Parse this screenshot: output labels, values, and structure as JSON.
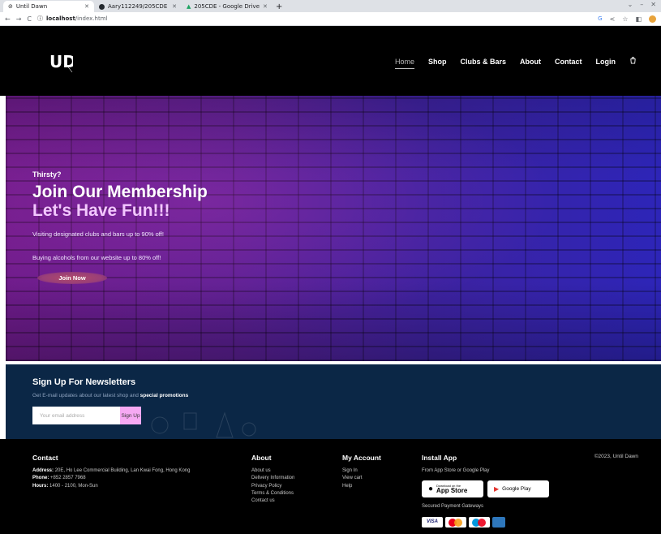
{
  "browser": {
    "tabs": [
      {
        "title": "Until Dawn",
        "active": true
      },
      {
        "title": "Aary112249/205CDE",
        "active": false
      },
      {
        "title": "205CDE - Google Drive",
        "active": false
      }
    ],
    "new_tab_symbol": "+",
    "url_host": "localhost",
    "url_path": "/index.html",
    "icons": [
      "back-icon",
      "forward-icon",
      "reload-icon",
      "info-icon",
      "google-icon",
      "share-icon",
      "star-icon",
      "sidebar-icon",
      "profile-icon"
    ]
  },
  "header": {
    "logo_text": "UD",
    "nav": [
      {
        "label": "Home",
        "active": true
      },
      {
        "label": "Shop"
      },
      {
        "label": "Clubs & Bars"
      },
      {
        "label": "About"
      },
      {
        "label": "Contact"
      },
      {
        "label": "Login"
      }
    ],
    "bag_icon": "shopping-bag-icon"
  },
  "hero": {
    "kicker": "Thirsty?",
    "title": "Join Our Membership",
    "title2": "Let's Have Fun!!!",
    "line1": "Visiting designated clubs and bars up to 90% off!",
    "line2": "Buying alcohols from our website up to 80% off!",
    "button": "Join Now",
    "colors": {
      "left": "#6d1b8a",
      "right": "#2d25b8"
    }
  },
  "newsletter": {
    "heading": "Sign Up For Newsletters",
    "sub_prefix": "Get E-mail updates about our latest shop and ",
    "sub_highlight": "special promotions",
    "placeholder": "Your email address",
    "button": "Sign Up",
    "bg": "#0b2746",
    "button_color": "#f6a9f3"
  },
  "footer": {
    "contact": {
      "heading": "Contact",
      "address_label": "Address:",
      "address": "20E, Ho Lee Commercial Building, Lan Kwai Fong, Hong Kong",
      "phone_label": "Phone:",
      "phone": "+852 2857 7968",
      "hours_label": "Hours:",
      "hours": "1400 - 2100, Mon-Sun"
    },
    "about": {
      "heading": "About",
      "links": [
        "About us",
        "Delivery Information",
        "Privacy Policy",
        "Terms & Conditions",
        "Contact us"
      ]
    },
    "account": {
      "heading": "My Account",
      "links": [
        "Sign In",
        "View cart",
        "Help"
      ]
    },
    "install": {
      "heading": "Install App",
      "sub": "From App Store or Google Play",
      "appstore_small": "Download on the",
      "appstore_big": "App Store",
      "googleplay": "Google Play",
      "payments_label": "Secured Payment Gateways",
      "cards": [
        "VISA",
        "MasterCard",
        "Maestro",
        "AMEX"
      ]
    },
    "copyright": "©2023, Until Dawn"
  }
}
